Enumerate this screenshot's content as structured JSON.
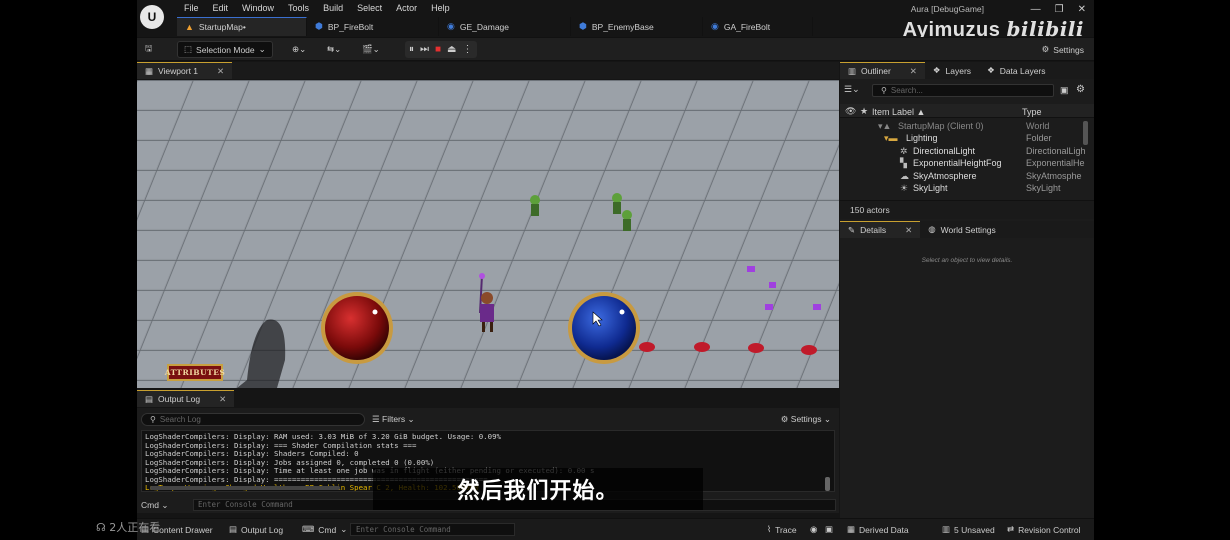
{
  "app": {
    "logo": "U",
    "menu": [
      "File",
      "Edit",
      "Window",
      "Tools",
      "Build",
      "Select",
      "Actor",
      "Help"
    ],
    "window_info": "Aura [DebugGame]",
    "tabs": [
      {
        "label": "StartupMap•",
        "icon": "level-icon"
      },
      {
        "label": "BP_FireBolt",
        "icon": "blueprint-icon"
      },
      {
        "label": "GE_Damage",
        "icon": "gameplay-effect-icon"
      },
      {
        "label": "BP_EnemyBase",
        "icon": "blueprint-icon"
      },
      {
        "label": "GA_FireBolt",
        "icon": "gameplay-ability-icon"
      }
    ],
    "watermark": "Ayimuzus",
    "watermark_site": "bilibili",
    "settings_label": "Settings"
  },
  "toolbar": {
    "selection_mode": "Selection Mode"
  },
  "viewport": {
    "tab_label": "Viewport 1",
    "hud_button": "ATTRIBUTES"
  },
  "outliner": {
    "tabs": [
      "Outliner",
      "Layers",
      "Data Layers"
    ],
    "search_placeholder": "Search...",
    "col_label": "Item Label ▲",
    "col_type": "Type",
    "rows": [
      {
        "label": "StartupMap (Client 0)",
        "type": "World",
        "indent": 0,
        "dim": true
      },
      {
        "label": "Lighting",
        "type": "Folder",
        "indent": 1,
        "dim": false
      },
      {
        "label": "DirectionalLight",
        "type": "DirectionalLigh",
        "indent": 2,
        "dim": false
      },
      {
        "label": "ExponentialHeightFog",
        "type": "ExponentialHe",
        "indent": 2,
        "dim": false
      },
      {
        "label": "SkyAtmosphere",
        "type": "SkyAtmosphe",
        "indent": 2,
        "dim": false
      },
      {
        "label": "SkyLight",
        "type": "SkyLight",
        "indent": 2,
        "dim": false
      }
    ],
    "actor_count": "150 actors"
  },
  "details": {
    "tabs": [
      "Details",
      "World Settings"
    ],
    "empty_text": "Select an object to view details."
  },
  "output_log": {
    "tab_label": "Output Log",
    "search_placeholder": "Search Log",
    "filters_label": "Filters",
    "settings_label": "Settings",
    "lines": [
      {
        "text": "LogShaderCompilers: Display: RAM used: 3.03 MiB of 3.20 GiB budget. Usage: 0.09%",
        "warn": false
      },
      {
        "text": "LogShaderCompilers: Display: === Shader Compilation stats ===",
        "warn": false
      },
      {
        "text": "LogShaderCompilers: Display: Shaders Compiled: 0",
        "warn": false
      },
      {
        "text": "LogShaderCompilers: Display: Jobs assigned 0, completed 0 (0.00%)",
        "warn": false
      },
      {
        "text": "LogShaderCompilers: Display: Time at least one job was in flight (either pending or executed): 0.00 s",
        "warn": false
      },
      {
        "text": "LogShaderCompilers: Display: ================================================",
        "warn": false
      },
      {
        "text": "LogTemp: Warning: Changed Health on BP_Goblin_Spear_C_2, Health: 102.500000",
        "warn": true
      }
    ],
    "cmd_label": "Cmd",
    "console_placeholder": "Enter Console Command"
  },
  "statusbar": {
    "content_drawer": "Content Drawer",
    "output_log": "Output Log",
    "cmd": "Cmd",
    "console_placeholder": "Enter Console Command",
    "trace": "Trace",
    "derived_data": "Derived Data",
    "unsaved": "5 Unsaved",
    "revision_control": "Revision Control"
  },
  "overlay": {
    "subtitle": "然后我们开始。",
    "viewers": "2人正在看"
  },
  "colors": {
    "accent": "#3a6fd0",
    "health": "#a01818",
    "mana": "#1a3aa8",
    "warn": "#e6b800"
  }
}
